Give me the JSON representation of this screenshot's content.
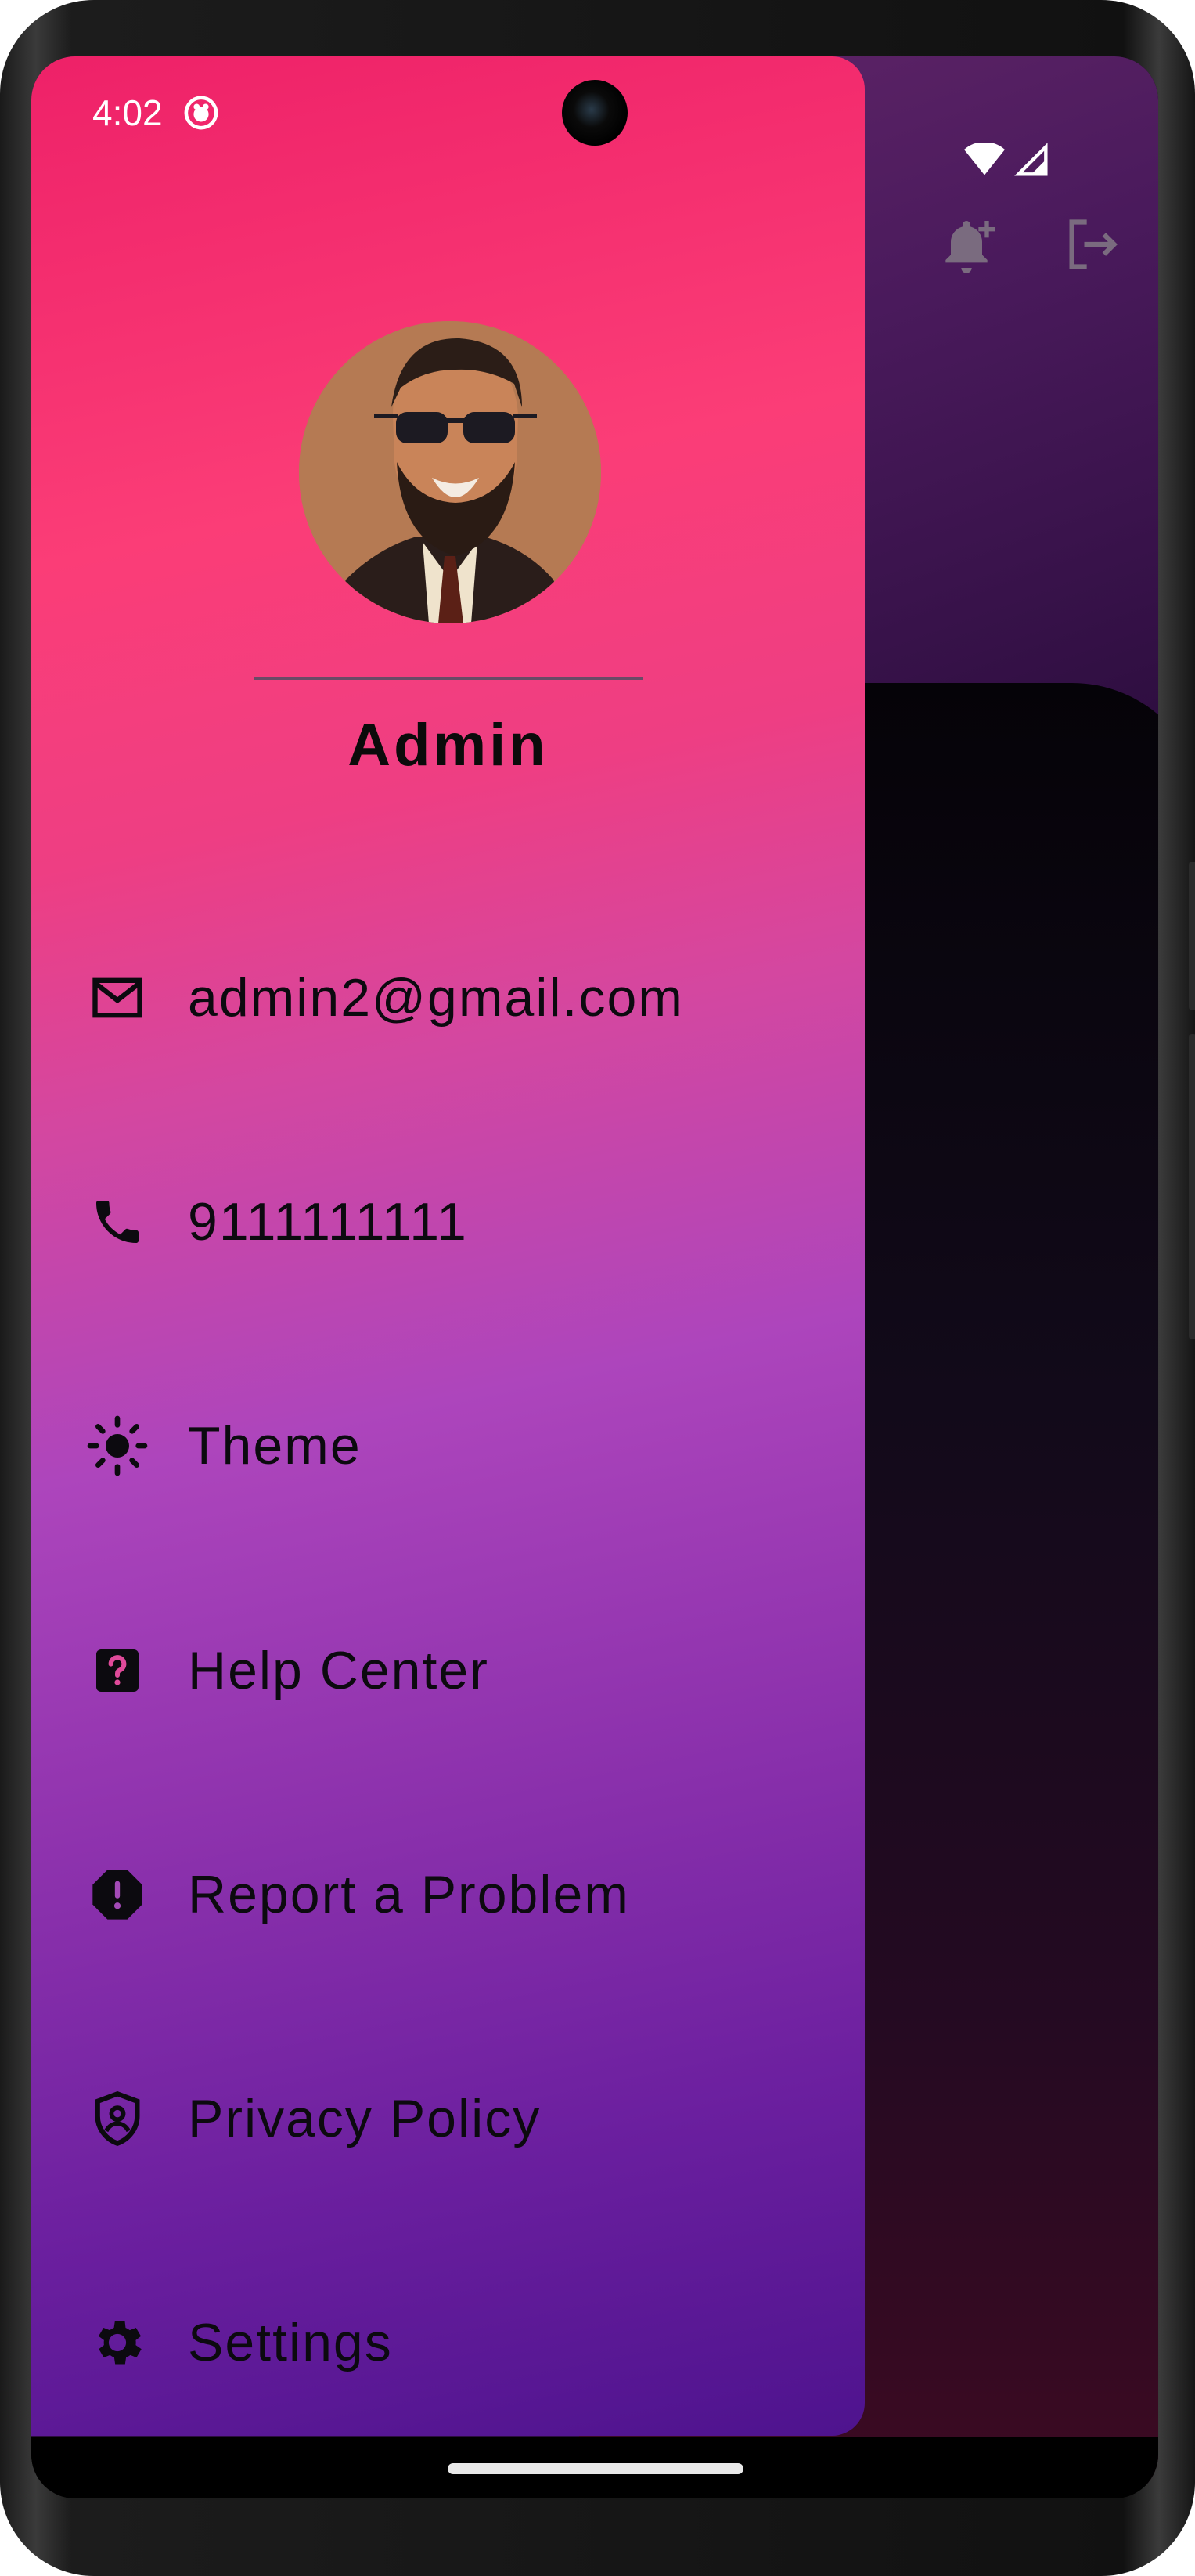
{
  "status_bar": {
    "time": "4:02"
  },
  "drawer": {
    "user_name": "Admin",
    "menu": [
      {
        "icon": "mail-icon",
        "label": "admin2@gmail.com"
      },
      {
        "icon": "phone-icon",
        "label": "9111111111"
      },
      {
        "icon": "sun-icon",
        "label": "Theme"
      },
      {
        "icon": "help-icon",
        "label": "Help Center"
      },
      {
        "icon": "report-icon",
        "label": "Report a Problem"
      },
      {
        "icon": "shield-icon",
        "label": "Privacy Policy"
      },
      {
        "icon": "gear-icon",
        "label": "Settings"
      }
    ]
  },
  "app_bar": {
    "actions": [
      "add-notification-icon",
      "logout-icon"
    ]
  },
  "colors": {
    "drawer_top": "#ee2168",
    "drawer_mid": "#ad45bc",
    "drawer_bottom": "#4e138e",
    "text": "#0c0a0f"
  }
}
